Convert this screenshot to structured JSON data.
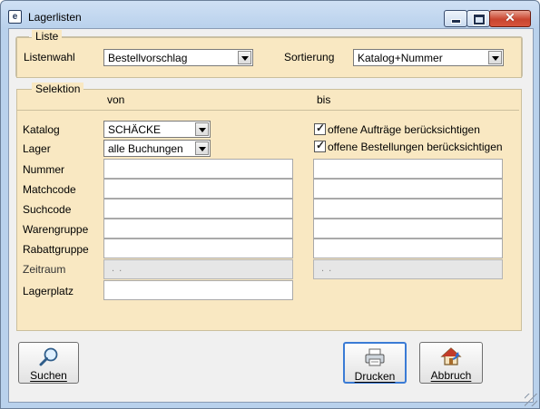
{
  "window": {
    "title": "Lagerlisten",
    "icon": "app-icon"
  },
  "liste": {
    "legend": "Liste",
    "listenwahl_label": "Listenwahl",
    "listenwahl_value": "Bestellvorschlag",
    "sortierung_label": "Sortierung",
    "sortierung_value": "Katalog+Nummer"
  },
  "selektion": {
    "legend": "Selektion",
    "von_header": "von",
    "bis_header": "bis",
    "katalog_label": "Katalog",
    "katalog_value": "SCHÄCKE",
    "lager_label": "Lager",
    "lager_value": "alle Buchungen",
    "nummer_label": "Nummer",
    "matchcode_label": "Matchcode",
    "suchcode_label": "Suchcode",
    "warengruppe_label": "Warengruppe",
    "rabattgruppe_label": "Rabattgruppe",
    "zeitraum_label": "Zeitraum",
    "zeitraum_von_placeholder": ". .",
    "zeitraum_bis_placeholder": ". .",
    "lagerplatz_label": "Lagerplatz",
    "offene_auftraege_label": "offene Aufträge berücksichtigen",
    "offene_auftraege_checked": true,
    "offene_bestellungen_label": "offene Bestellungen berücksichtigen",
    "offene_bestellungen_checked": true
  },
  "buttons": {
    "suchen": "Suchen",
    "drucken": "Drucken",
    "abbruch": "Abbruch"
  }
}
